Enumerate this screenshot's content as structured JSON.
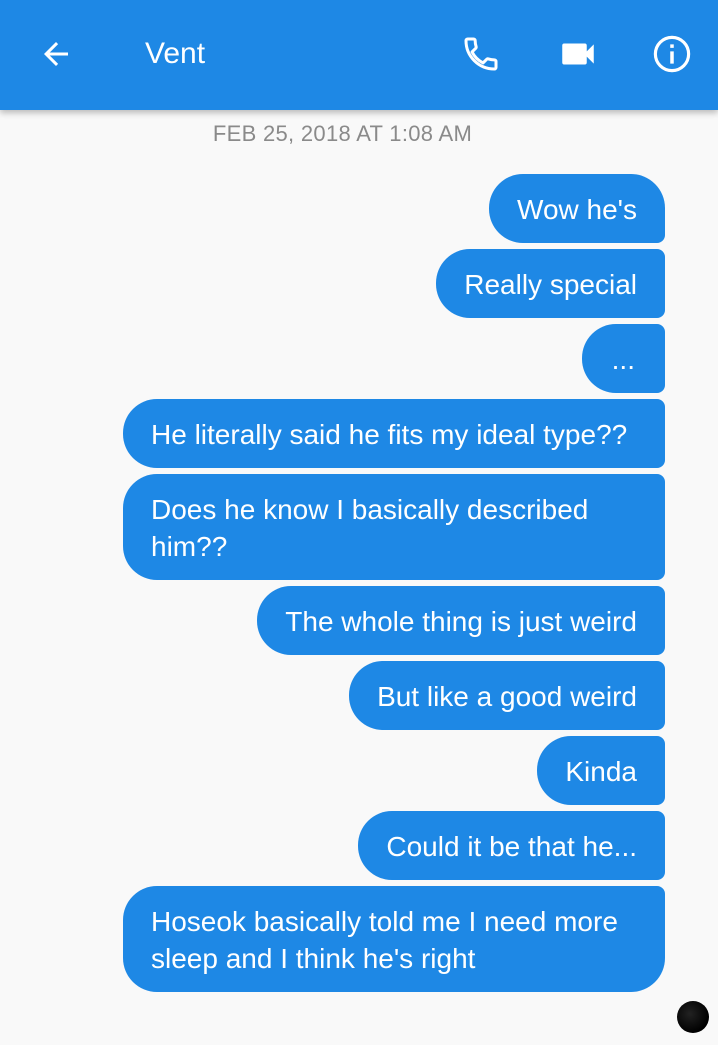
{
  "header": {
    "title": "Vent",
    "background": "#1e88e5",
    "icons": {
      "back": "arrow-left-icon",
      "call": "phone-icon",
      "video": "video-camera-icon",
      "info": "info-icon"
    }
  },
  "thread": {
    "timestamp": "FEB 25, 2018 AT 1:08 AM",
    "bubble_color": "#1e88e5",
    "messages": [
      {
        "text": "Wow he's"
      },
      {
        "text": "Really special"
      },
      {
        "text": "..."
      },
      {
        "text": "He literally said he fits my ideal type??"
      },
      {
        "text": "Does he know I basically described him??"
      },
      {
        "text": "The whole thing is just weird"
      },
      {
        "text": "But like a good weird"
      },
      {
        "text": "Kinda"
      },
      {
        "text": "Could it be that he..."
      },
      {
        "text": "Hoseok basically told me I need more sleep and I think he's right"
      }
    ]
  }
}
